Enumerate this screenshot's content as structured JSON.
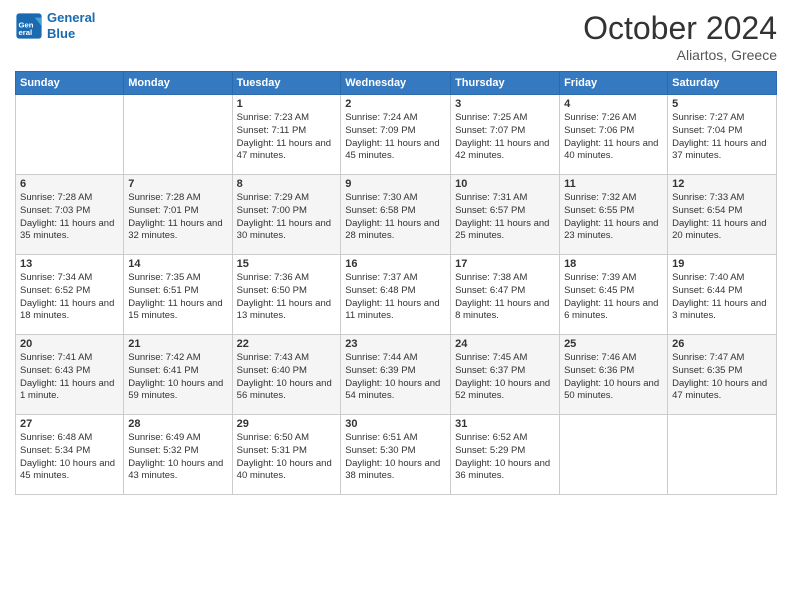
{
  "logo": {
    "line1": "General",
    "line2": "Blue"
  },
  "title": "October 2024",
  "location": "Aliartos, Greece",
  "days_header": [
    "Sunday",
    "Monday",
    "Tuesday",
    "Wednesday",
    "Thursday",
    "Friday",
    "Saturday"
  ],
  "weeks": [
    [
      {
        "day": "",
        "info": ""
      },
      {
        "day": "",
        "info": ""
      },
      {
        "day": "1",
        "info": "Sunrise: 7:23 AM\nSunset: 7:11 PM\nDaylight: 11 hours and 47 minutes."
      },
      {
        "day": "2",
        "info": "Sunrise: 7:24 AM\nSunset: 7:09 PM\nDaylight: 11 hours and 45 minutes."
      },
      {
        "day": "3",
        "info": "Sunrise: 7:25 AM\nSunset: 7:07 PM\nDaylight: 11 hours and 42 minutes."
      },
      {
        "day": "4",
        "info": "Sunrise: 7:26 AM\nSunset: 7:06 PM\nDaylight: 11 hours and 40 minutes."
      },
      {
        "day": "5",
        "info": "Sunrise: 7:27 AM\nSunset: 7:04 PM\nDaylight: 11 hours and 37 minutes."
      }
    ],
    [
      {
        "day": "6",
        "info": "Sunrise: 7:28 AM\nSunset: 7:03 PM\nDaylight: 11 hours and 35 minutes."
      },
      {
        "day": "7",
        "info": "Sunrise: 7:28 AM\nSunset: 7:01 PM\nDaylight: 11 hours and 32 minutes."
      },
      {
        "day": "8",
        "info": "Sunrise: 7:29 AM\nSunset: 7:00 PM\nDaylight: 11 hours and 30 minutes."
      },
      {
        "day": "9",
        "info": "Sunrise: 7:30 AM\nSunset: 6:58 PM\nDaylight: 11 hours and 28 minutes."
      },
      {
        "day": "10",
        "info": "Sunrise: 7:31 AM\nSunset: 6:57 PM\nDaylight: 11 hours and 25 minutes."
      },
      {
        "day": "11",
        "info": "Sunrise: 7:32 AM\nSunset: 6:55 PM\nDaylight: 11 hours and 23 minutes."
      },
      {
        "day": "12",
        "info": "Sunrise: 7:33 AM\nSunset: 6:54 PM\nDaylight: 11 hours and 20 minutes."
      }
    ],
    [
      {
        "day": "13",
        "info": "Sunrise: 7:34 AM\nSunset: 6:52 PM\nDaylight: 11 hours and 18 minutes."
      },
      {
        "day": "14",
        "info": "Sunrise: 7:35 AM\nSunset: 6:51 PM\nDaylight: 11 hours and 15 minutes."
      },
      {
        "day": "15",
        "info": "Sunrise: 7:36 AM\nSunset: 6:50 PM\nDaylight: 11 hours and 13 minutes."
      },
      {
        "day": "16",
        "info": "Sunrise: 7:37 AM\nSunset: 6:48 PM\nDaylight: 11 hours and 11 minutes."
      },
      {
        "day": "17",
        "info": "Sunrise: 7:38 AM\nSunset: 6:47 PM\nDaylight: 11 hours and 8 minutes."
      },
      {
        "day": "18",
        "info": "Sunrise: 7:39 AM\nSunset: 6:45 PM\nDaylight: 11 hours and 6 minutes."
      },
      {
        "day": "19",
        "info": "Sunrise: 7:40 AM\nSunset: 6:44 PM\nDaylight: 11 hours and 3 minutes."
      }
    ],
    [
      {
        "day": "20",
        "info": "Sunrise: 7:41 AM\nSunset: 6:43 PM\nDaylight: 11 hours and 1 minute."
      },
      {
        "day": "21",
        "info": "Sunrise: 7:42 AM\nSunset: 6:41 PM\nDaylight: 10 hours and 59 minutes."
      },
      {
        "day": "22",
        "info": "Sunrise: 7:43 AM\nSunset: 6:40 PM\nDaylight: 10 hours and 56 minutes."
      },
      {
        "day": "23",
        "info": "Sunrise: 7:44 AM\nSunset: 6:39 PM\nDaylight: 10 hours and 54 minutes."
      },
      {
        "day": "24",
        "info": "Sunrise: 7:45 AM\nSunset: 6:37 PM\nDaylight: 10 hours and 52 minutes."
      },
      {
        "day": "25",
        "info": "Sunrise: 7:46 AM\nSunset: 6:36 PM\nDaylight: 10 hours and 50 minutes."
      },
      {
        "day": "26",
        "info": "Sunrise: 7:47 AM\nSunset: 6:35 PM\nDaylight: 10 hours and 47 minutes."
      }
    ],
    [
      {
        "day": "27",
        "info": "Sunrise: 6:48 AM\nSunset: 5:34 PM\nDaylight: 10 hours and 45 minutes."
      },
      {
        "day": "28",
        "info": "Sunrise: 6:49 AM\nSunset: 5:32 PM\nDaylight: 10 hours and 43 minutes."
      },
      {
        "day": "29",
        "info": "Sunrise: 6:50 AM\nSunset: 5:31 PM\nDaylight: 10 hours and 40 minutes."
      },
      {
        "day": "30",
        "info": "Sunrise: 6:51 AM\nSunset: 5:30 PM\nDaylight: 10 hours and 38 minutes."
      },
      {
        "day": "31",
        "info": "Sunrise: 6:52 AM\nSunset: 5:29 PM\nDaylight: 10 hours and 36 minutes."
      },
      {
        "day": "",
        "info": ""
      },
      {
        "day": "",
        "info": ""
      }
    ]
  ]
}
